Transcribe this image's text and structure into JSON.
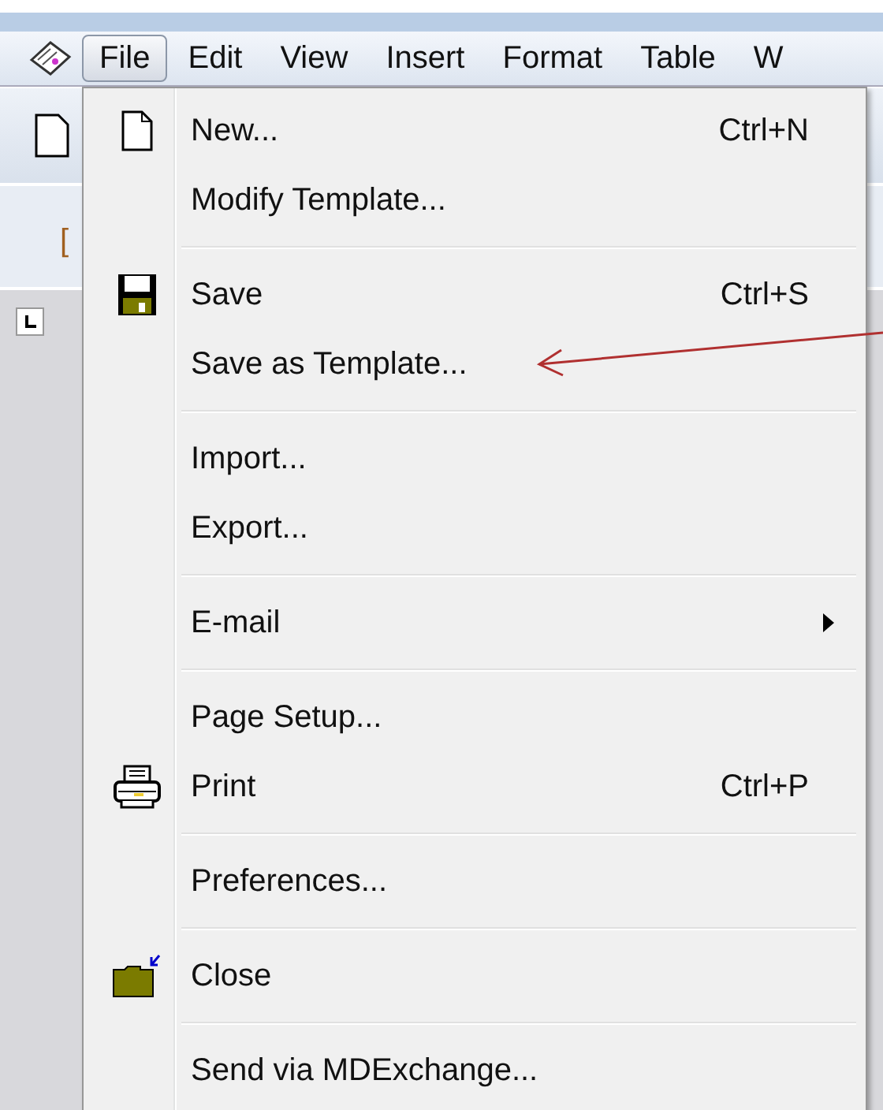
{
  "menu_bar": [
    {
      "label": "File",
      "selected": true
    },
    {
      "label": "Edit",
      "selected": false
    },
    {
      "label": "View",
      "selected": false
    },
    {
      "label": "Insert",
      "selected": false
    },
    {
      "label": "Format",
      "selected": false
    },
    {
      "label": "Table",
      "selected": false
    },
    {
      "label": "W",
      "selected": false
    }
  ],
  "background": {
    "field_text": "["
  },
  "file_menu": [
    [
      {
        "label": "New...",
        "shortcut": "Ctrl+N",
        "kind": "page"
      },
      {
        "label": "Modify Template..."
      }
    ],
    [
      {
        "label": "Save",
        "shortcut": "Ctrl+S",
        "kind": "floppy"
      },
      {
        "label": "Save as Template..."
      }
    ],
    [
      {
        "label": "Import..."
      },
      {
        "label": "Export..."
      }
    ],
    [
      {
        "label": "E-mail",
        "submenu": true
      }
    ],
    [
      {
        "label": "Page Setup..."
      },
      {
        "label": "Print",
        "shortcut": "Ctrl+P",
        "kind": "printer"
      }
    ],
    [
      {
        "label": "Preferences..."
      }
    ],
    [
      {
        "label": "Close",
        "kind": "folder"
      }
    ],
    [
      {
        "label": "Send via MDExchange..."
      }
    ]
  ]
}
